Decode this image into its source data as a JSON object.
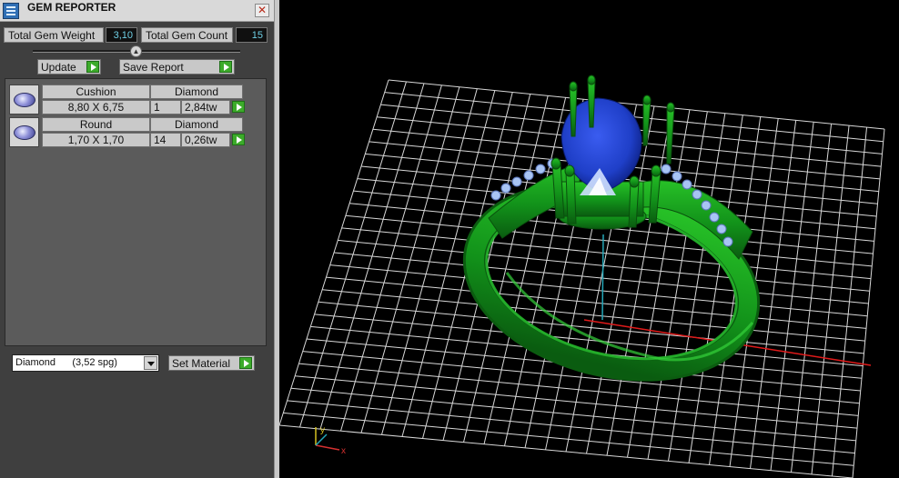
{
  "window": {
    "title": "GEM REPORTER",
    "close_glyph": "✕"
  },
  "stats": {
    "weight_label": "Total Gem Weight",
    "weight_value": "3,10",
    "count_label": "Total Gem Count",
    "count_value": "15"
  },
  "toolbar": {
    "update_label": "Update",
    "save_report_label": "Save Report"
  },
  "gems": [
    {
      "shape": "Cushion",
      "material": "Diamond",
      "size": "8,80 X 6,75",
      "count": "1",
      "weight": "2,84tw"
    },
    {
      "shape": "Round",
      "material": "Diamond",
      "size": "1,70 X 1,70",
      "count": "14",
      "weight": "0,26tw"
    }
  ],
  "material": {
    "selected": "Diamond      (3,52 spg)",
    "set_label": "Set Material"
  },
  "axis_gizmo": {
    "y": "y",
    "x": "x"
  },
  "colors": {
    "metal": "#169a16",
    "center_stone": "#1f3fc8",
    "side_stones": "#a8c4f4",
    "grid": "#ffffff",
    "x_axis": "#e01a1a",
    "z_axis": "#24a7b8",
    "go_button": "#3cab2a"
  },
  "icons": [
    "gem-reporter-app-icon",
    "close-icon",
    "go-arrow-icon",
    "gem-thumbnail",
    "dropdown-arrow-icon",
    "axis-gizmo"
  ]
}
